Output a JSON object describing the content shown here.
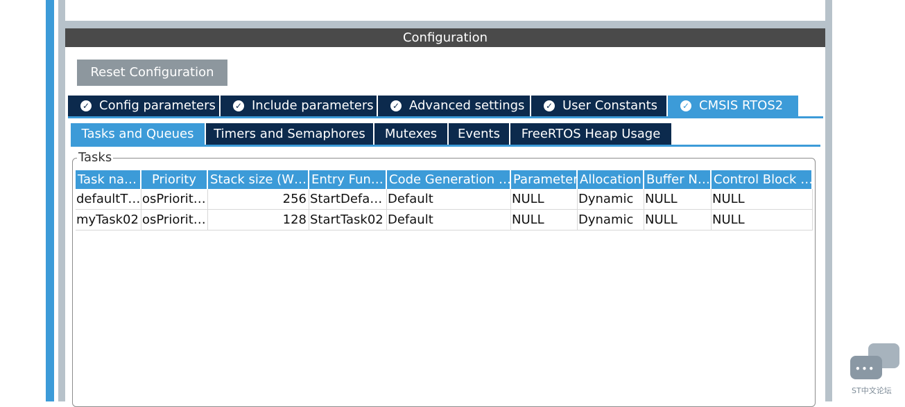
{
  "header": {
    "title": "Configuration"
  },
  "toolbar": {
    "reset_label": "Reset Configuration"
  },
  "tabs_top": [
    {
      "label": "Config parameters",
      "active": false
    },
    {
      "label": "Include parameters",
      "active": false
    },
    {
      "label": "Advanced settings",
      "active": false
    },
    {
      "label": "User Constants",
      "active": false
    },
    {
      "label": "CMSIS RTOS2",
      "active": true
    }
  ],
  "tabs_sub": [
    {
      "label": "Tasks and Queues",
      "active": true
    },
    {
      "label": "Timers and Semaphores",
      "active": false
    },
    {
      "label": "Mutexes",
      "active": false
    },
    {
      "label": "Events",
      "active": false
    },
    {
      "label": "FreeRTOS Heap Usage",
      "active": false
    }
  ],
  "tasks": {
    "legend": "Tasks",
    "columns": [
      "Task na…",
      "Priority",
      "Stack size (W…",
      "Entry Fun…",
      "Code Generation …",
      "Parameter",
      "Allocation",
      "Buffer N…",
      "Control Block …"
    ],
    "rows": [
      [
        "defaultT…",
        "osPriorit…",
        "256",
        "StartDefa…",
        "Default",
        "NULL",
        "Dynamic",
        "NULL",
        "NULL"
      ],
      [
        "myTask02",
        "osPriorit…",
        "128",
        "StartTask02",
        "Default",
        "NULL",
        "Dynamic",
        "NULL",
        "NULL"
      ]
    ]
  },
  "colors": {
    "accent": "#3c9bd8",
    "tab_dark": "#0c2a4d",
    "header_bg": "#4a4a4a",
    "button_bg": "#8d979e"
  },
  "icons": {
    "tab_check": "check-circle-icon",
    "watermark": "chat-bubbles-icon"
  },
  "watermark": {
    "text": "ST中文论坛"
  }
}
